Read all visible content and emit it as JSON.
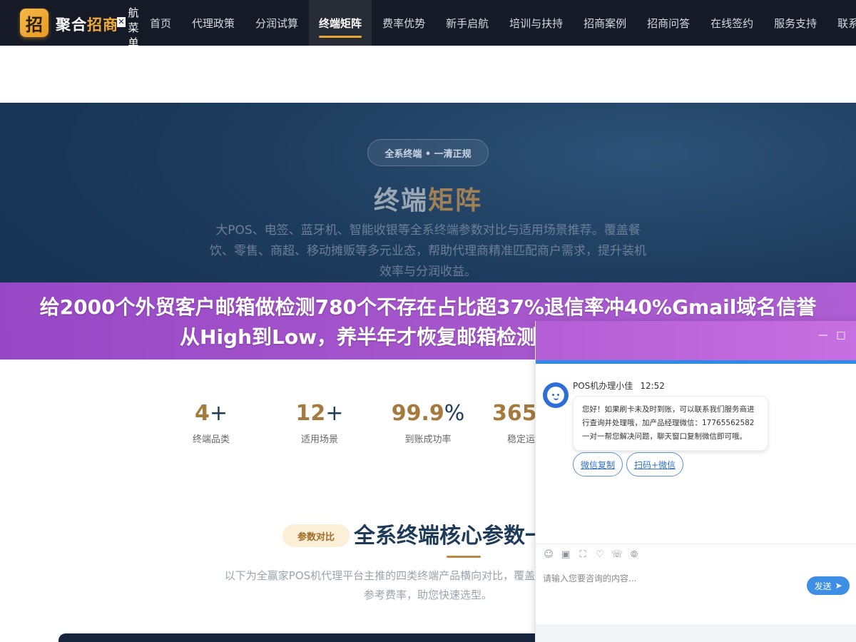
{
  "nav": {
    "logo_char": "招",
    "brand_part1": "聚合",
    "brand_part2": "招商",
    "close_symbol": "✕",
    "menu_label": [
      "航",
      "菜",
      "单"
    ],
    "links": [
      "首页",
      "代理政策",
      "分润试算",
      "终端矩阵",
      "费率优势",
      "新手启航",
      "培训与扶持",
      "招商案例",
      "招商问答",
      "在线签约",
      "服务支持",
      "联系"
    ],
    "active_index": 3
  },
  "hero": {
    "tag": "全系终端 • 一清正规",
    "title_part1": "终端",
    "title_part2": "矩阵",
    "description": "大POS、电签、蓝牙机、智能收银等全系终端参数对比与适用场景推荐。覆盖餐饮、零售、商超、移动摊贩等多元业态，帮助代理商精准匹配商户需求，提升装机效率与分润收益。"
  },
  "promo": {
    "text": "给2000个外贸客户邮箱做检测780个不存在占比超37%退信率冲40%Gmail域名信誉从High到Low，养半年才恢复邮箱检测清单含所有指标"
  },
  "stats": [
    {
      "value": "4",
      "suffix": "+",
      "label": "终端品类"
    },
    {
      "value": "12",
      "suffix": "+",
      "label": "适用场景"
    },
    {
      "value": "99.9",
      "suffix": "%",
      "label": "到账成功率"
    },
    {
      "value": "365",
      "suffix": "",
      "label": "稳定运"
    }
  ],
  "section": {
    "tag": "参数对比",
    "title": "全系终端核心参数一",
    "description": "以下为全赢家POS机代理平台主推的四类终端产品横向对比，覆盖置、适用商户类型及参考费率，助您快速选型。"
  },
  "chat": {
    "agent_name": "POS机办理小佳",
    "time": "12:52",
    "message": "您好！如果刷卡未及时到账，可以联系我们服务商进行查询并处理哦，加产品经理微信：17765562582 一对一帮您解决问题，聊天窗口复制微信即可哦。",
    "quick_buttons": [
      "微信复制",
      "扫码+微信"
    ],
    "input_placeholder": "请输入您要咨询的内容...",
    "send_label": "发送",
    "minimize_symbol": "—",
    "maximize_symbol": "□",
    "tool_icons": [
      "smile-icon",
      "image-icon",
      "screenshot-icon",
      "rate-icon",
      "voice-icon",
      "chat-bubbles-icon"
    ]
  },
  "colors": {
    "nav_bg": "#151a26",
    "accent_gold": "#e9a53a",
    "hero_bg": "#1d3b5c",
    "promo_purple": "#a956cf",
    "chat_blue": "#3d8fe5"
  }
}
